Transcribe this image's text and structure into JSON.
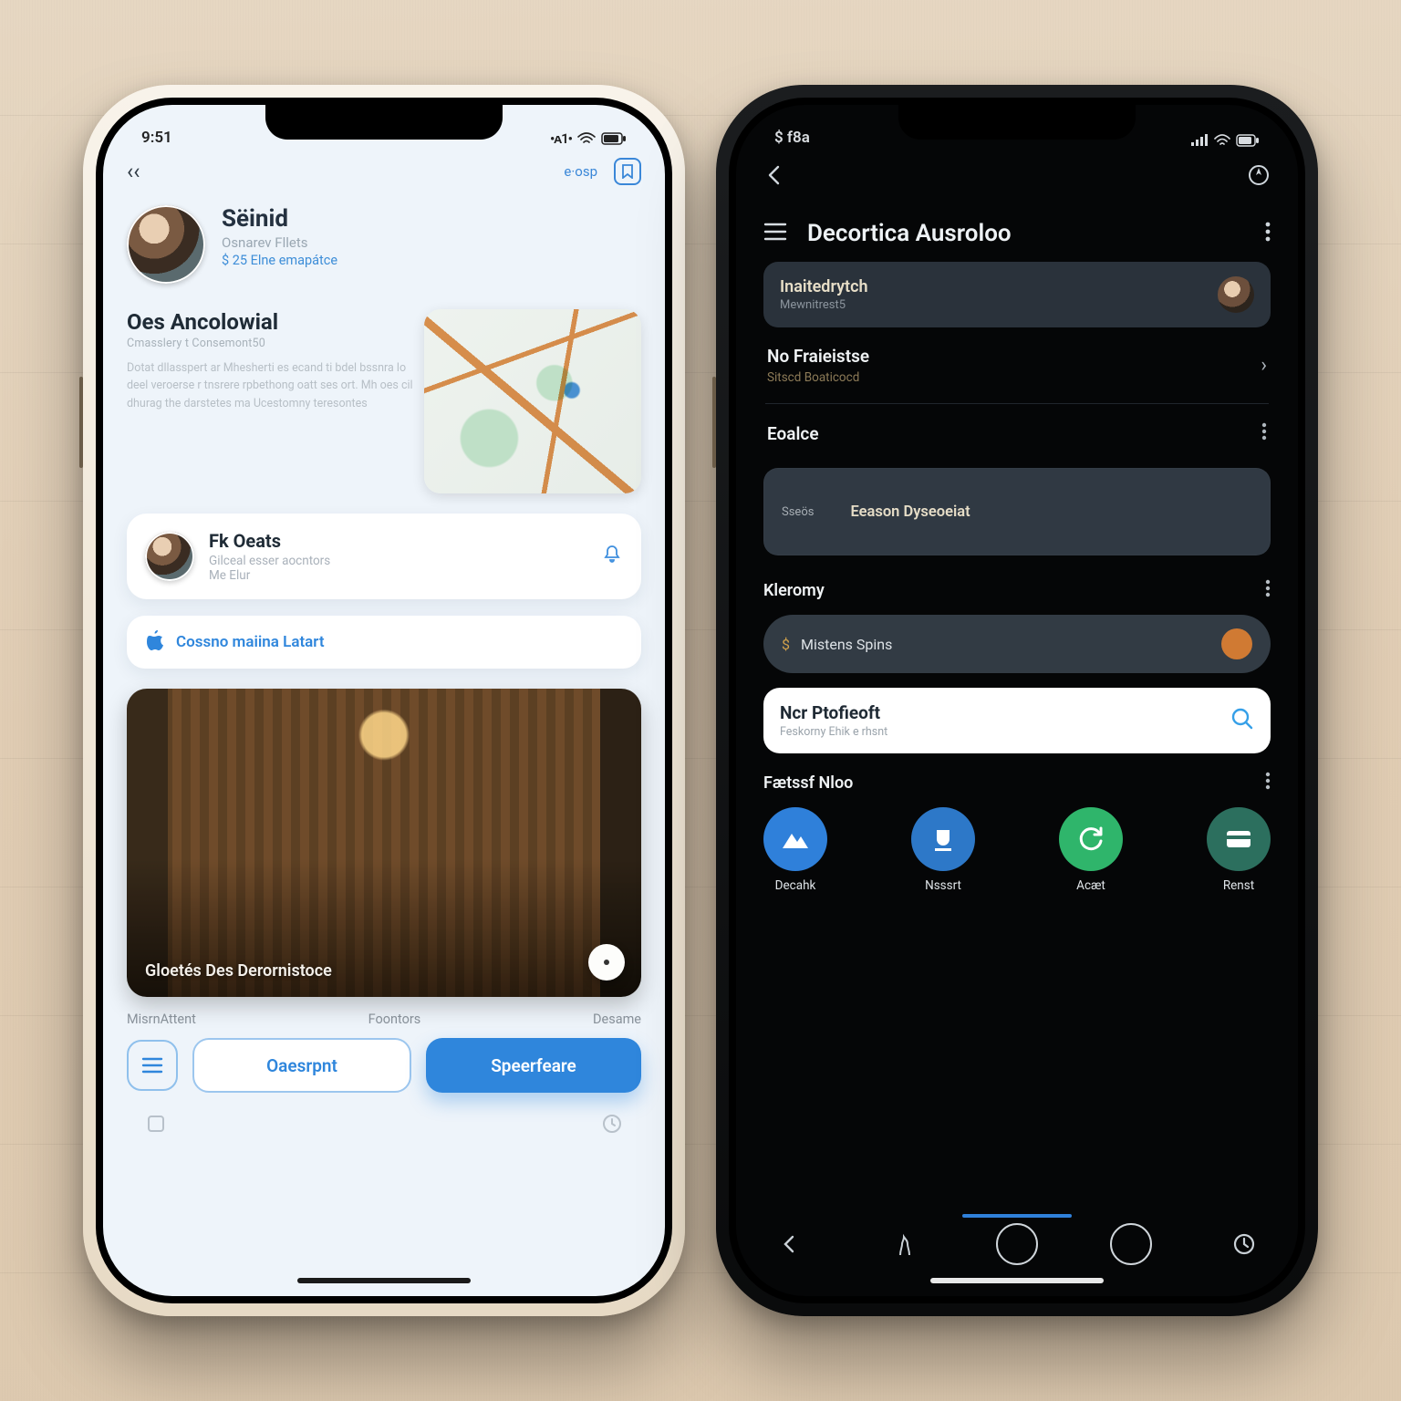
{
  "left": {
    "status": {
      "time": "9:51",
      "carrier": "•ᴀ1•"
    },
    "topbar": {
      "back": "‹‹",
      "link": "e·osp"
    },
    "profile": {
      "name": "Sëinid",
      "subtitle": "Osnarev Fllets",
      "meta": "$ 25 Elne emapátce"
    },
    "section": {
      "title": "Oes Ancolowial",
      "sub": "Cmasslery t Consemont50",
      "para": "Dotat dllasspert ar Mhesherti es ecand ti bdel bssnra lo deel veroerse r tnsrere rpbethong oatt ses ort. Mh oes cil dhurag the darstetes ma Ucestomny teresontes"
    },
    "card1": {
      "title": "Fk Oeats",
      "sub1": "Gilceal esser aocntors",
      "sub2": "Me Elur"
    },
    "linkcard": {
      "label": "Cossno maiina Latart"
    },
    "photo": {
      "caption": "Gloetés Des Derornistoce"
    },
    "footer": {
      "left": "MisrnAttent",
      "mid": "Foontors",
      "right": "Desame"
    },
    "cta": {
      "outline": "Oaesrpnt",
      "solid": "Speerfeare"
    }
  },
  "right": {
    "status": {
      "time": "$ f8a"
    },
    "header": {
      "title": "Decortica Ausroloo"
    },
    "chip": {
      "title": "Inaitedrytch",
      "sub": "Mewnitrest5"
    },
    "row1": {
      "title": "No Fraieistse",
      "sub": "Sitscd Boaticocd"
    },
    "row2": {
      "title": "Eoalce"
    },
    "panel": {
      "small": "Sseös",
      "mid": "Eeason Dyseoeiat"
    },
    "section2": "Kleromy",
    "pill": {
      "label": "Mistens Spins"
    },
    "whiteCard": {
      "title": "Ncr Ptofieoft",
      "sub": "Feskorny Ehik e rhsnt"
    },
    "quickHeader": "Fætssf Nloo",
    "quick": [
      {
        "label": "Decahk"
      },
      {
        "label": "Nsssrt"
      },
      {
        "label": "Acæt"
      },
      {
        "label": "Renst"
      }
    ]
  }
}
